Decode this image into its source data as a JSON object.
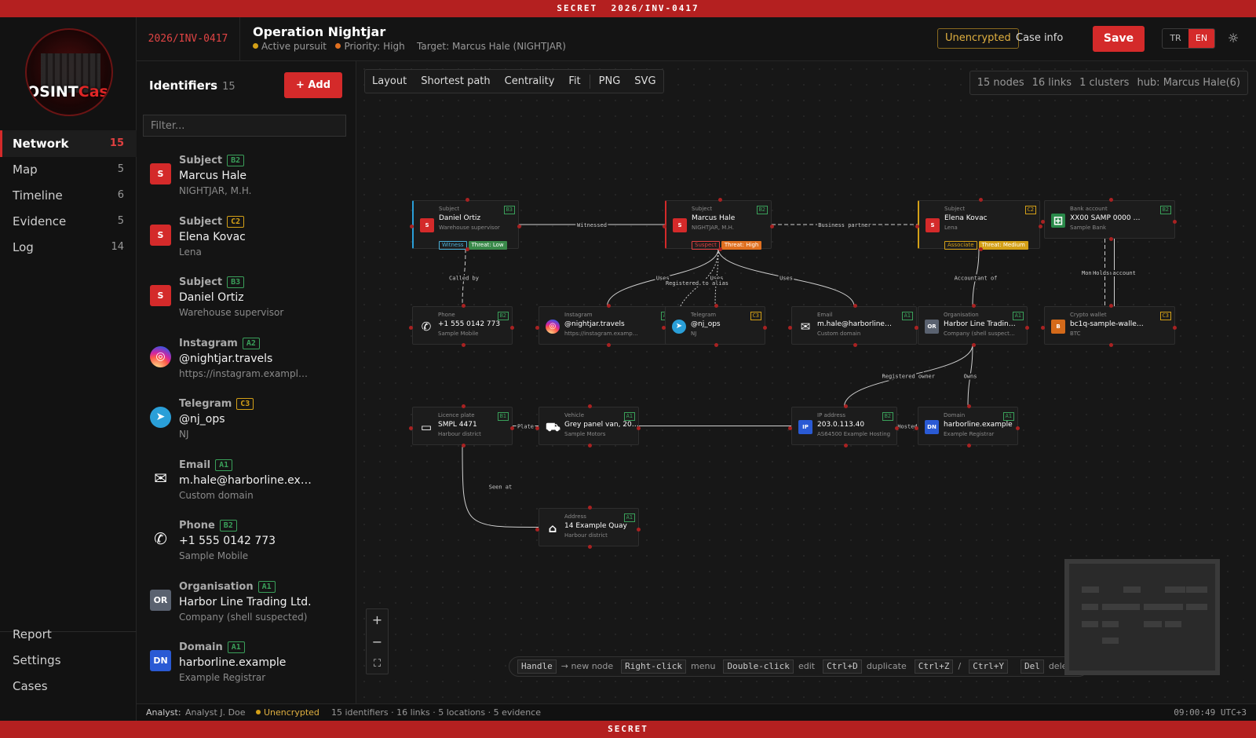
{
  "banner": {
    "top_label": "SECRET",
    "top_case": "2026/INV-0417",
    "bottom_label": "SECRET"
  },
  "logo": {
    "text_a": "OSINT",
    "text_b": "Case"
  },
  "nav": {
    "items": [
      {
        "label": "Network",
        "count": "15"
      },
      {
        "label": "Map",
        "count": "5"
      },
      {
        "label": "Timeline",
        "count": "6"
      },
      {
        "label": "Evidence",
        "count": "5"
      },
      {
        "label": "Log",
        "count": "14"
      }
    ],
    "bottom": [
      "Report",
      "Settings",
      "Cases"
    ]
  },
  "header": {
    "case_id": "2026/INV-0417",
    "title": "Operation Nightjar",
    "status": "Active pursuit",
    "priority": "Priority: High",
    "target": "Target: Marcus Hale (NIGHTJAR)",
    "unencrypted_label": "Unencrypted",
    "case_info_label": "Case info",
    "save_label": "Save",
    "lang": [
      "TR",
      "EN"
    ],
    "lang_active": "EN",
    "colors": {
      "status_dot": "#d4a017",
      "priority_dot": "#e07020",
      "accent": "#d42a2a"
    }
  },
  "identifiers": {
    "title": "Identifiers",
    "count": "15",
    "add_label": "+ Add",
    "filter_placeholder": "Filter...",
    "items": [
      {
        "type": "Subject",
        "badge": "B2",
        "value": "Marcus Hale",
        "sub": "NIGHTJAR, M.H.",
        "icon": "S",
        "icon_name": "subject-icon"
      },
      {
        "type": "Subject",
        "badge": "C2",
        "value": "Elena Kovac",
        "sub": "Lena",
        "icon": "S",
        "icon_name": "subject-icon"
      },
      {
        "type": "Subject",
        "badge": "B3",
        "value": "Daniel Ortiz",
        "sub": "Warehouse supervisor",
        "icon": "S",
        "icon_name": "subject-icon"
      },
      {
        "type": "Instagram",
        "badge": "A2",
        "value": "@nightjar.travels",
        "sub": "https://instagram.example/...",
        "icon": "",
        "icon_name": "instagram-icon"
      },
      {
        "type": "Telegram",
        "badge": "C3",
        "value": "@nj_ops",
        "sub": "NJ",
        "icon": "",
        "icon_name": "telegram-icon"
      },
      {
        "type": "Email",
        "badge": "A1",
        "value": "m.hale@harborline.exa...",
        "sub": "Custom domain",
        "icon": "",
        "icon_name": "envelope-icon"
      },
      {
        "type": "Phone",
        "badge": "B2",
        "value": "+1 555 0142 773",
        "sub": "Sample Mobile",
        "icon": "",
        "icon_name": "phone-icon"
      },
      {
        "type": "Organisation",
        "badge": "A1",
        "value": "Harbor Line Trading Ltd.",
        "sub": "Company (shell suspected)",
        "icon": "OR",
        "icon_name": "organisation-icon"
      },
      {
        "type": "Domain",
        "badge": "A1",
        "value": "harborline.example",
        "sub": "Example Registrar",
        "icon": "DN",
        "icon_name": "domain-icon"
      }
    ]
  },
  "toolbar": [
    "Layout",
    "Shortest path",
    "Centrality",
    "Fit",
    "PNG",
    "SVG"
  ],
  "stats": [
    "15 nodes",
    "16 links",
    "1 clusters",
    "hub: Marcus Hale(6)"
  ],
  "graph": {
    "nodes": [
      {
        "id": "ortiz",
        "type": "Subject",
        "value": "Daniel Ortiz",
        "sub": "Warehouse supervisor",
        "badge": "B3",
        "icon": "S",
        "tags": [
          {
            "t": "Witness",
            "c": "witness"
          },
          {
            "t": "Threat: Low",
            "c": "low"
          }
        ]
      },
      {
        "id": "hale",
        "type": "Subject",
        "value": "Marcus Hale",
        "sub": "NIGHTJAR, M.H.",
        "badge": "B2",
        "icon": "S",
        "tags": [
          {
            "t": "Suspect",
            "c": "suspect"
          },
          {
            "t": "Threat: High",
            "c": "high"
          }
        ]
      },
      {
        "id": "kovac",
        "type": "Subject",
        "value": "Elena Kovac",
        "sub": "Lena",
        "badge": "C2",
        "icon": "S",
        "tags": [
          {
            "t": "Associate",
            "c": "assoc"
          },
          {
            "t": "Threat: Medium",
            "c": "med"
          }
        ]
      },
      {
        "id": "bank",
        "type": "Bank account",
        "value": "XX00 SAMP 0000 0000 000...",
        "sub": "Sample Bank",
        "badge": "B2",
        "icon": "bank"
      },
      {
        "id": "phone",
        "type": "Phone",
        "value": "+1 555 0142 773",
        "sub": "Sample Mobile",
        "badge": "B2",
        "icon": "phone"
      },
      {
        "id": "insta",
        "type": "Instagram",
        "value": "@nightjar.travels",
        "sub": "https://instagram.example/nightj...",
        "badge": "A2",
        "icon": "insta"
      },
      {
        "id": "tg",
        "type": "Telegram",
        "value": "@nj_ops",
        "sub": "NJ",
        "badge": "C3",
        "icon": "tg"
      },
      {
        "id": "email",
        "type": "Email",
        "value": "m.hale@harborline.example",
        "sub": "Custom domain",
        "badge": "A1",
        "icon": "mail"
      },
      {
        "id": "org",
        "type": "Organisation",
        "value": "Harbor Line Trading Ltd.",
        "sub": "Company (shell suspected)",
        "badge": "A1",
        "icon": "OR"
      },
      {
        "id": "wallet",
        "type": "Crypto wallet",
        "value": "bc1q-sample-wallet-0000-ni...",
        "sub": "BTC",
        "badge": "C3",
        "icon": "B"
      },
      {
        "id": "plate",
        "type": "Licence plate",
        "value": "SMPL 4471",
        "sub": "Harbour district",
        "badge": "B1",
        "icon": "plate"
      },
      {
        "id": "van",
        "type": "Vehicle",
        "value": "Grey panel van, 2019",
        "sub": "Sample Motors",
        "badge": "A1",
        "icon": "car"
      },
      {
        "id": "ip",
        "type": "IP address",
        "value": "203.0.113.40",
        "sub": "AS64500 Example Hosting",
        "badge": "B2",
        "icon": "IP"
      },
      {
        "id": "domain",
        "type": "Domain",
        "value": "harborline.example",
        "sub": "Example Registrar",
        "badge": "A1",
        "icon": "DN"
      },
      {
        "id": "addr",
        "type": "Address",
        "value": "14 Example Quay",
        "sub": "Harbour district",
        "badge": "A1",
        "icon": "house"
      }
    ],
    "edges": [
      {
        "from": "ortiz",
        "to": "hale",
        "label": "Witnessed",
        "style": "solid"
      },
      {
        "from": "hale",
        "to": "kovac",
        "label": "Business partner",
        "style": "dashed"
      },
      {
        "from": "ortiz",
        "to": "phone",
        "label": "Called by",
        "style": "dashed"
      },
      {
        "from": "hale",
        "to": "insta",
        "label": "Uses",
        "style": "solid"
      },
      {
        "from": "hale",
        "to": "tg",
        "label": "Uses",
        "style": "dotted"
      },
      {
        "from": "hale",
        "to": "tg",
        "label": "Registered to alias",
        "style": "dotted"
      },
      {
        "from": "hale",
        "to": "email",
        "label": "Uses",
        "style": "solid"
      },
      {
        "from": "kovac",
        "to": "org",
        "label": "Accountant of",
        "style": "solid"
      },
      {
        "from": "bank",
        "to": "wallet",
        "label": "Money transfer",
        "style": "dashed"
      },
      {
        "from": "wallet",
        "to": "bank",
        "label": "Holds account",
        "style": "solid"
      },
      {
        "from": "org",
        "to": "domain",
        "label": "Owns",
        "style": "solid"
      },
      {
        "from": "org",
        "to": "ip",
        "label": "Registered owner",
        "style": "solid"
      },
      {
        "from": "plate",
        "to": "van",
        "label": "Plate",
        "style": "solid"
      },
      {
        "from": "van",
        "to": "ip",
        "label": "",
        "style": "solid"
      },
      {
        "from": "ip",
        "to": "domain",
        "label": "Hosted",
        "style": "solid"
      },
      {
        "from": "plate",
        "to": "addr",
        "label": "Seen at",
        "style": "solid"
      }
    ]
  },
  "hints": [
    {
      "key": "Handle",
      "text": "→ new node"
    },
    {
      "key": "Right-click",
      "text": "menu"
    },
    {
      "key": "Double-click",
      "text": "edit"
    },
    {
      "key": "Ctrl+D",
      "text": "duplicate"
    },
    {
      "key": "Ctrl+Z",
      "text": "/"
    },
    {
      "key": "Ctrl+Y",
      "text": ""
    },
    {
      "key": "Del",
      "text": "delete"
    }
  ],
  "statusbar": {
    "analyst_label": "Analyst:",
    "analyst": "Analyst J. Doe",
    "encryption": "Unencrypted",
    "summary": "15 identifiers · 16 links · 5 locations · 5 evidence",
    "clock": "09:00:49 UTC+3"
  }
}
